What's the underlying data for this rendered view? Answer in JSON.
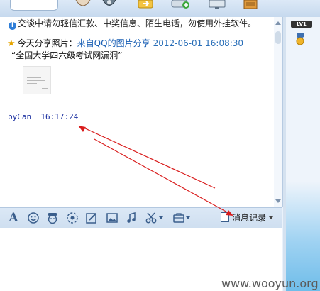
{
  "chat": {
    "notice": "交谈中请勿轻信汇款、中奖信息、陌生电话，勿使用外挂软件。",
    "share": {
      "prefix": "今天分享照片：",
      "source": "来自QQ的图片分享",
      "timestamp": "2012-06-01 16:08:30",
      "title": "“全国大学四六级考试网漏洞”"
    },
    "message": {
      "sender": "byCan",
      "time": "16:17:24"
    }
  },
  "input_toolbar": {
    "history_label": "消息记录"
  },
  "side_panel": {
    "level_badge": "LV1"
  },
  "watermark": "www.wooyun.org",
  "colors": {
    "annotation_arrow": "#d91c1c",
    "link": "#1a5fb4",
    "sender": "#1a2fa0"
  }
}
